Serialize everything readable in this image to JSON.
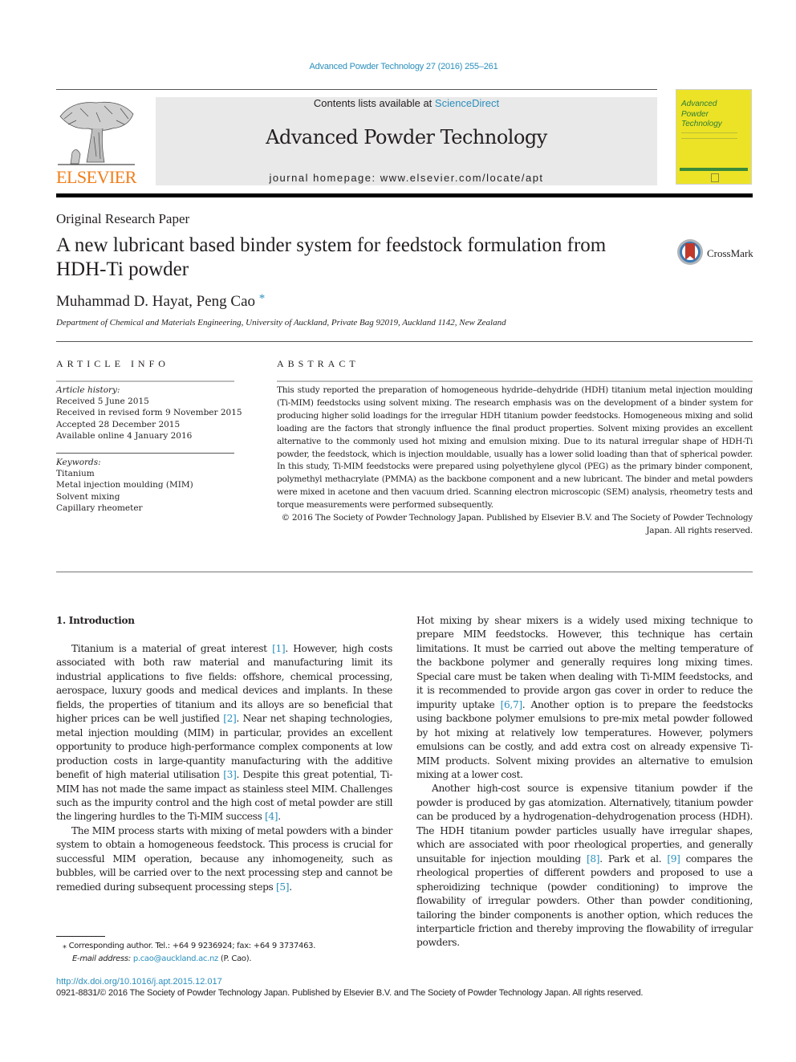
{
  "header": {
    "journal_ref": "Advanced Powder Technology 27 (2016) 255–261",
    "contents_prefix": "Contents lists available at ",
    "contents_link": "ScienceDirect",
    "journal_name": "Advanced Powder Technology",
    "homepage_prefix": "journal homepage: ",
    "homepage_url": "www.elsevier.com/locate/apt",
    "publisher_logo_text": "ELSEVIER",
    "cover": {
      "title_line1": "Advanced",
      "title_line2": "Powder",
      "title_line3": "Technology"
    },
    "colors": {
      "link": "#2a8fbd",
      "elsevier_orange": "#f07d1a",
      "cover_yellow": "#ece327",
      "masthead_gray": "#e9e9e9"
    }
  },
  "article": {
    "type": "Original Research Paper",
    "title": "A new lubricant based binder system for feedstock formulation from HDH-Ti powder",
    "authors": "Muhammad D. Hayat, Peng Cao",
    "author_mark": "*",
    "affiliation": "Department of Chemical and Materials Engineering, University of Auckland, Private Bag 92019, Auckland 1142, New Zealand",
    "crossmark_label": "CrossMark"
  },
  "article_info": {
    "heading": "ARTICLE INFO",
    "history_label": "Article history:",
    "history": [
      "Received 5 June 2015",
      "Received in revised form 9 November 2015",
      "Accepted 28 December 2015",
      "Available online 4 January 2016"
    ],
    "keywords_label": "Keywords:",
    "keywords": [
      "Titanium",
      "Metal injection moulding (MIM)",
      "Solvent mixing",
      "Capillary rheometer"
    ]
  },
  "abstract": {
    "heading": "ABSTRACT",
    "text": "This study reported the preparation of homogeneous hydride–dehydride (HDH) titanium metal injection moulding (Ti-MIM) feedstocks using solvent mixing. The research emphasis was on the development of a binder system for producing higher solid loadings for the irregular HDH titanium powder feedstocks. Homogeneous mixing and solid loading are the factors that strongly influence the final product properties. Solvent mixing provides an excellent alternative to the commonly used hot mixing and emulsion mixing. Due to its natural irregular shape of HDH-Ti powder, the feedstock, which is injection mouldable, usually has a lower solid loading than that of spherical powder. In this study, Ti-MIM feedstocks were prepared using polyethylene glycol (PEG) as the primary binder component, polymethyl methacrylate (PMMA) as the backbone component and a new lubricant. The binder and metal powders were mixed in acetone and then vacuum dried. Scanning electron microscopic (SEM) analysis, rheometry tests and torque measurements were performed subsequently.",
    "copyright": "© 2016 The Society of Powder Technology Japan. Published by Elsevier B.V. and The Society of Powder Technology Japan. All rights reserved."
  },
  "body": {
    "intro_heading": "1. Introduction",
    "left": {
      "p1": [
        {
          "t": "Titanium is a material of great interest "
        },
        {
          "t": "[1]",
          "ref": true
        },
        {
          "t": ". However, high costs associated with both raw material and manufacturing limit its industrial applications to five fields: offshore, chemical processing, aerospace, luxury goods and medical devices and implants. In these fields, the properties of titanium and its alloys are so beneficial that higher prices can be well justified "
        },
        {
          "t": "[2]",
          "ref": true
        },
        {
          "t": ". Near net shaping technologies, metal injection moulding (MIM) in particular, provides an excellent opportunity to produce high-performance complex components at low production costs in large-quantity manufacturing with the additive benefit of high material utilisation "
        },
        {
          "t": "[3]",
          "ref": true
        },
        {
          "t": ". Despite this great potential, Ti-MIM has not made the same impact as stainless steel MIM. Challenges such as the impurity control and the high cost of metal powder are still the lingering hurdles to the Ti-MIM success "
        },
        {
          "t": "[4]",
          "ref": true
        },
        {
          "t": "."
        }
      ],
      "p2": [
        {
          "t": "The MIM process starts with mixing of metal powders with a binder system to obtain a homogeneous feedstock. This process is crucial for successful MIM operation, because any inhomogeneity, such as bubbles, will be carried over to the next processing step and cannot be remedied during subsequent processing steps "
        },
        {
          "t": "[5]",
          "ref": true
        },
        {
          "t": "."
        }
      ]
    },
    "right": {
      "p1": [
        {
          "t": "Hot mixing by shear mixers is a widely used mixing technique to prepare MIM feedstocks. However, this technique has certain limitations. It must be carried out above the melting temperature of the backbone polymer and generally requires long mixing times. Special care must be taken when dealing with Ti-MIM feedstocks, and it is recommended to provide argon gas cover in order to reduce the impurity uptake "
        },
        {
          "t": "[6,7]",
          "ref": true
        },
        {
          "t": ". Another option is to prepare the feedstocks using backbone polymer emulsions to pre-mix metal powder followed by hot mixing at relatively low temperatures. However, polymers emulsions can be costly, and add extra cost on already expensive Ti-MIM products. Solvent mixing provides an alternative to emulsion mixing at a lower cost."
        }
      ],
      "p2": [
        {
          "t": "Another high-cost source is expensive titanium powder if the powder is produced by gas atomization. Alternatively, titanium powder can be produced by a hydrogenation–dehydrogenation process (HDH). The HDH titanium powder particles usually have irregular shapes, which are associated with poor rheological properties, and generally unsuitable for injection moulding "
        },
        {
          "t": "[8]",
          "ref": true
        },
        {
          "t": ". Park et al. "
        },
        {
          "t": "[9]",
          "ref": true
        },
        {
          "t": " compares the rheological properties of different powders and proposed to use a spheroidizing technique (powder conditioning) to improve the flowability of irregular powders. Other than powder conditioning, tailoring the binder components is another option, which reduces the interparticle friction and thereby improving the flowability of irregular powders."
        }
      ]
    }
  },
  "footnote": {
    "mark": "⁎",
    "corresponding": "Corresponding author. Tel.: +64 9 9236924; fax: +64 9 3737463.",
    "email_label": "E-mail address:",
    "email": "p.cao@auckland.ac.nz",
    "email_suffix": " (P. Cao)."
  },
  "footer": {
    "doi": "http://dx.doi.org/10.1016/j.apt.2015.12.017",
    "copyright": "0921-8831/© 2016 The Society of Powder Technology Japan. Published by Elsevier B.V. and The Society of Powder Technology Japan. All rights reserved."
  }
}
